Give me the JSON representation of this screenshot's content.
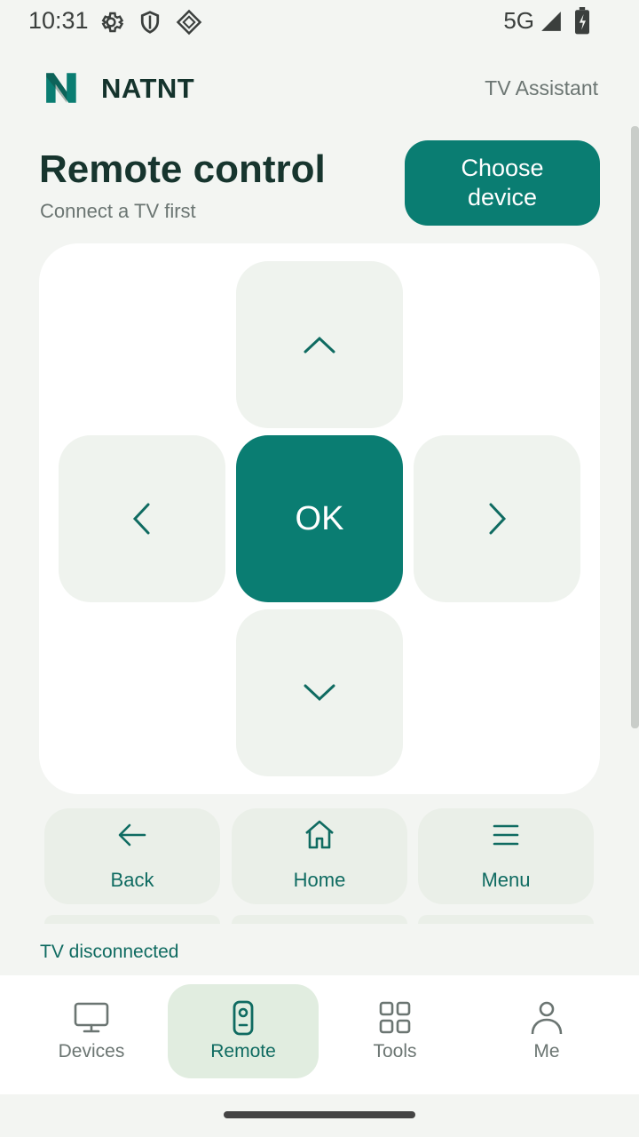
{
  "status_bar": {
    "time": "10:31",
    "network": "5G",
    "icons": [
      "settings-icon",
      "shield-icon",
      "vpn-diamond-icon",
      "signal-icon",
      "battery-charging-icon"
    ]
  },
  "header": {
    "brand": "NATNT",
    "app_name": "TV Assistant",
    "logo_icon": "natnt-logo-icon"
  },
  "page": {
    "title": "Remote control",
    "subtitle": "Connect a TV first",
    "choose_device_label": "Choose device"
  },
  "dpad": {
    "ok_label": "OK",
    "up_icon": "chevron-up-icon",
    "down_icon": "chevron-down-icon",
    "left_icon": "chevron-left-icon",
    "right_icon": "chevron-right-icon"
  },
  "actions": [
    {
      "label": "Back",
      "icon": "arrow-left-icon"
    },
    {
      "label": "Home",
      "icon": "home-icon"
    },
    {
      "label": "Menu",
      "icon": "menu-icon"
    }
  ],
  "tv_status": "TV disconnected",
  "bottom_nav": [
    {
      "label": "Devices",
      "icon": "tv-icon",
      "active": false
    },
    {
      "label": "Remote",
      "icon": "remote-icon",
      "active": true
    },
    {
      "label": "Tools",
      "icon": "grid-icon",
      "active": false
    },
    {
      "label": "Me",
      "icon": "person-icon",
      "active": false
    }
  ],
  "colors": {
    "accent": "#0a7d72",
    "background": "#f3f5f2",
    "button_surface": "#eff3ee",
    "nav_active": "#e1ede0"
  }
}
